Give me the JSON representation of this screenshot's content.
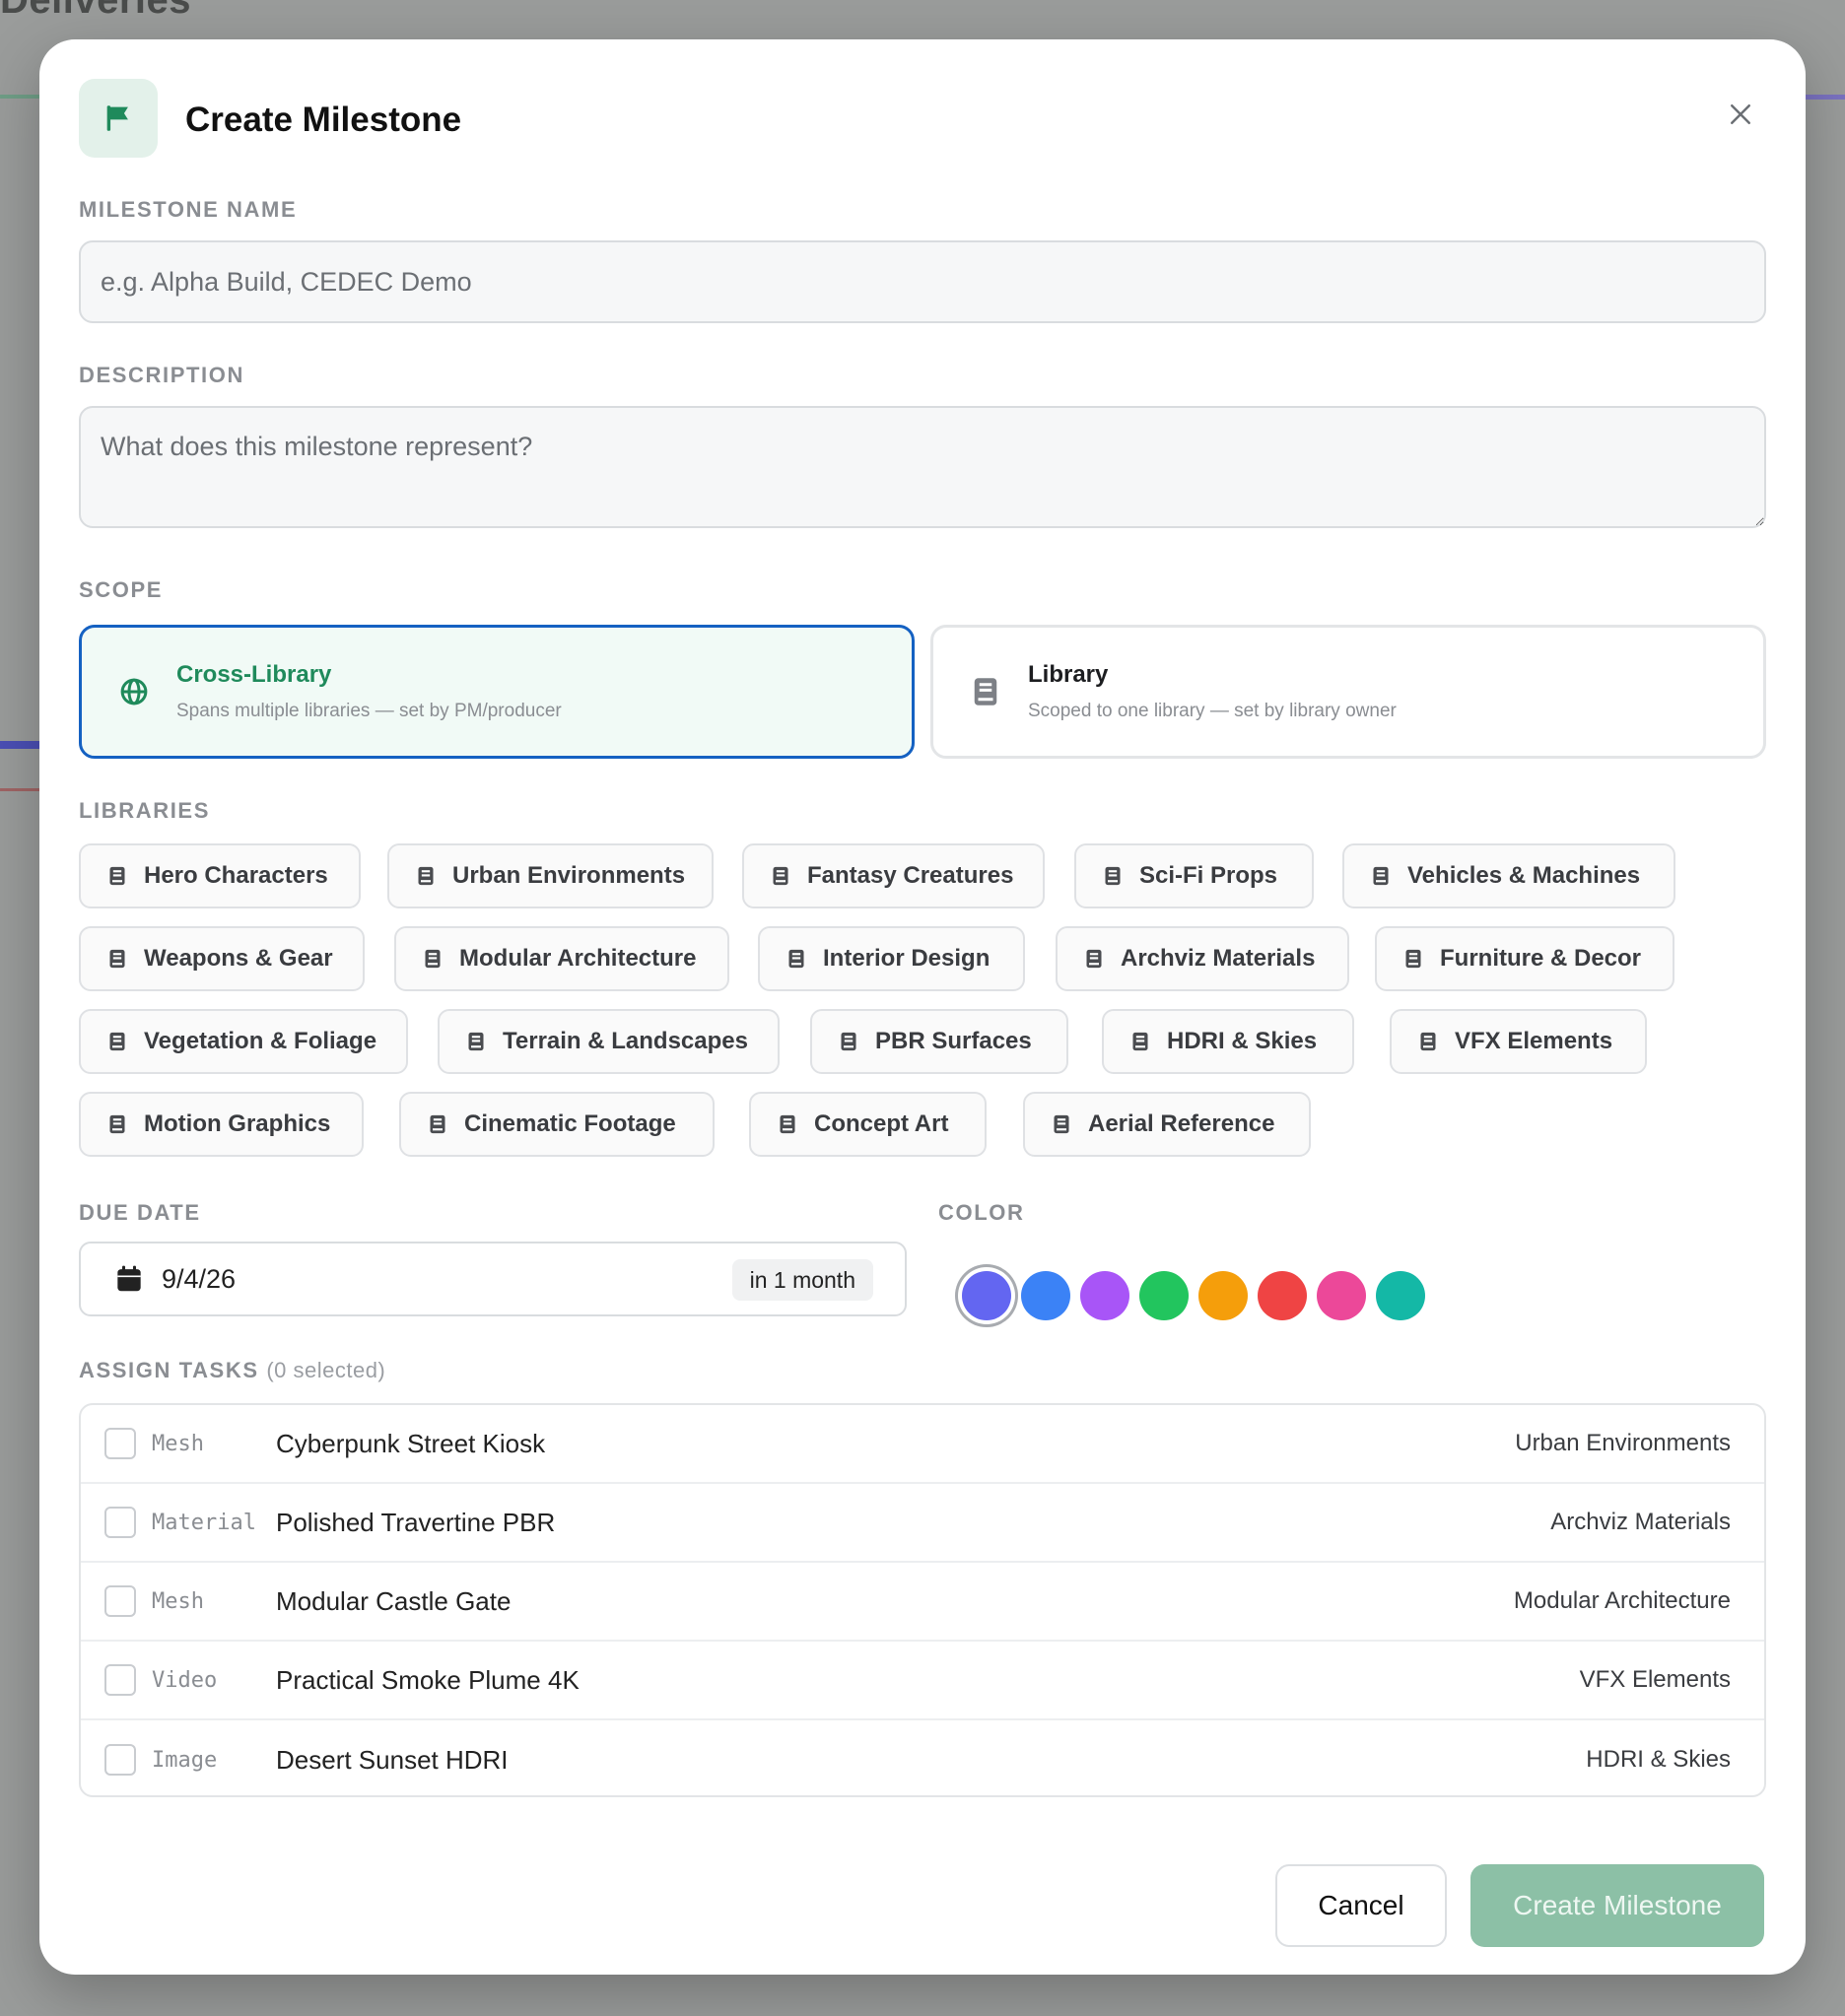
{
  "background": {
    "page_heading": "Deliveries"
  },
  "modal": {
    "title": "Create Milestone",
    "icons": {
      "header": "flag-icon",
      "close": "close-icon"
    }
  },
  "milestone_name": {
    "label": "MILESTONE NAME",
    "value": "",
    "placeholder": "e.g. Alpha Build, CEDEC Demo"
  },
  "description": {
    "label": "DESCRIPTION",
    "value": "",
    "placeholder": "What does this milestone represent?"
  },
  "scope": {
    "label": "SCOPE",
    "selected": "Cross-Library",
    "options": [
      {
        "title": "Cross-Library",
        "subtitle": "Spans multiple libraries — set by PM/producer",
        "icon": "globe-icon"
      },
      {
        "title": "Library",
        "subtitle": "Scoped to one library — set by library owner",
        "icon": "book-icon"
      }
    ]
  },
  "libraries": {
    "label": "LIBRARIES",
    "items": [
      "Hero Characters",
      "Urban Environments",
      "Fantasy Creatures",
      "Sci-Fi Props",
      "Vehicles & Machines",
      "Weapons & Gear",
      "Modular Architecture",
      "Interior Design",
      "Archviz Materials",
      "Furniture & Decor",
      "Vegetation & Foliage",
      "Terrain & Landscapes",
      "PBR Surfaces",
      "HDRI & Skies",
      "VFX Elements",
      "Motion Graphics",
      "Cinematic Footage",
      "Concept Art",
      "Aerial Reference"
    ]
  },
  "due_date": {
    "label": "DUE DATE",
    "value": "9/4/26",
    "relative": "in 1 month",
    "icon": "calendar-icon"
  },
  "color": {
    "label": "COLOR",
    "selected_index": 0,
    "swatches": [
      "#6366f1",
      "#3b82f6",
      "#a855f7",
      "#22c55e",
      "#f59e0b",
      "#ef4444",
      "#ec4899",
      "#14b8a6"
    ]
  },
  "assign_tasks": {
    "label": "ASSIGN TASKS",
    "selected_text": "(0 selected)",
    "tasks": [
      {
        "type": "Mesh",
        "name": "Cyberpunk Street Kiosk",
        "library": "Urban Environments",
        "checked": false
      },
      {
        "type": "Material",
        "name": "Polished Travertine PBR",
        "library": "Archviz Materials",
        "checked": false
      },
      {
        "type": "Mesh",
        "name": "Modular Castle Gate",
        "library": "Modular Architecture",
        "checked": false
      },
      {
        "type": "Video",
        "name": "Practical Smoke Plume 4K",
        "library": "VFX Elements",
        "checked": false
      },
      {
        "type": "Image",
        "name": "Desert Sunset HDRI",
        "library": "HDRI & Skies",
        "checked": false
      }
    ]
  },
  "buttons": {
    "cancel": "Cancel",
    "create": "Create Milestone"
  },
  "colors": {
    "accent_green": "#1f8a5b",
    "active_border": "#1561c2",
    "create_button_disabled": "#8cc0a6"
  }
}
